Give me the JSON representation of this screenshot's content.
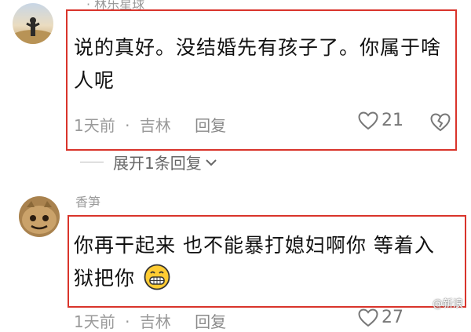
{
  "comments": [
    {
      "username": "· 林乐星球",
      "text": "说的真好。没结婚先有孩子了。你属于啥人呢",
      "time": "1天前",
      "location": "吉林",
      "reply_label": "回复",
      "likes": "21",
      "expand_label": "展开1条回复"
    },
    {
      "username": "香笋",
      "text": "你再干起来 也不能暴打媳妇啊你 等着入狱把你",
      "time": "1天前",
      "location": "吉林",
      "reply_label": "回复",
      "likes": "27"
    }
  ],
  "separator": "·",
  "watermark": "@新浪"
}
